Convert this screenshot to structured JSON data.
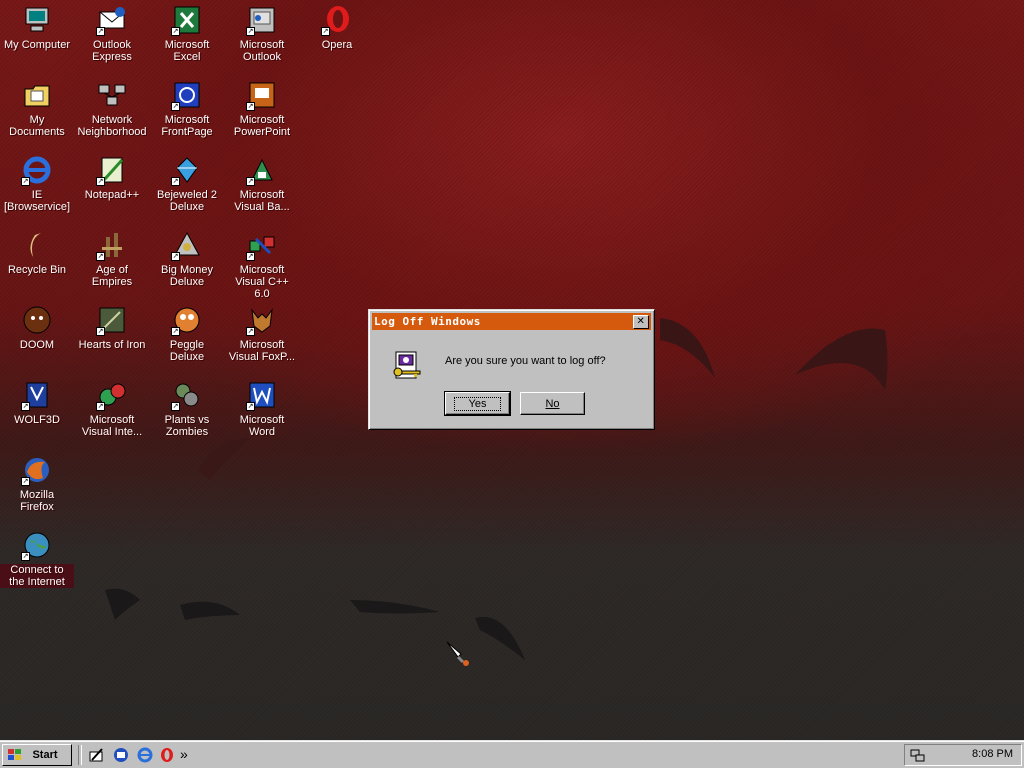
{
  "desktop": {
    "icons": [
      {
        "label": "My Computer",
        "icon": "computer-icon"
      },
      {
        "label": "Outlook Express",
        "icon": "outlook-express-icon"
      },
      {
        "label": "Microsoft Excel",
        "icon": "excel-icon"
      },
      {
        "label": "Microsoft Outlook",
        "icon": "outlook-icon"
      },
      {
        "label": "Opera",
        "icon": "opera-icon"
      },
      {
        "label": "My Documents",
        "icon": "documents-folder-icon"
      },
      {
        "label": "Network Neighborhood",
        "icon": "network-icon"
      },
      {
        "label": "Microsoft FrontPage",
        "icon": "frontpage-icon"
      },
      {
        "label": "Microsoft PowerPoint",
        "icon": "powerpoint-icon"
      },
      {
        "label": "IE [Browservice]",
        "icon": "internet-explorer-icon"
      },
      {
        "label": "Notepad++",
        "icon": "notepad-icon"
      },
      {
        "label": "Bejeweled 2 Deluxe",
        "icon": "bejeweled-icon"
      },
      {
        "label": "Microsoft Visual Ba...",
        "icon": "visual-basic-icon"
      },
      {
        "label": "Recycle Bin",
        "icon": "recycle-bin-icon"
      },
      {
        "label": "Age of Empires",
        "icon": "age-of-empires-icon"
      },
      {
        "label": "Big Money Deluxe",
        "icon": "big-money-icon"
      },
      {
        "label": "Microsoft Visual C++ 6.0",
        "icon": "visual-cpp-icon"
      },
      {
        "label": "DOOM",
        "icon": "doom-icon"
      },
      {
        "label": "Hearts of Iron",
        "icon": "hearts-of-iron-icon"
      },
      {
        "label": "Peggle Deluxe",
        "icon": "peggle-icon"
      },
      {
        "label": "Microsoft Visual FoxP...",
        "icon": "visual-foxpro-icon"
      },
      {
        "label": "WOLF3D",
        "icon": "wolf3d-icon"
      },
      {
        "label": "Microsoft Visual Inte...",
        "icon": "visual-interdev-icon"
      },
      {
        "label": "Plants vs Zombies",
        "icon": "plants-vs-zombies-icon"
      },
      {
        "label": "Microsoft Word",
        "icon": "word-icon"
      },
      {
        "label": "Mozilla Firefox",
        "icon": "firefox-icon"
      },
      {
        "label": "Connect to the Internet",
        "icon": "connect-internet-icon"
      }
    ]
  },
  "dialog": {
    "title": "Log Off Windows",
    "close_glyph": "✕",
    "message": "Are you sure you want to log off?",
    "yes_label": "Yes",
    "no_label": "No",
    "icon": "log-off-key-icon"
  },
  "taskbar": {
    "start_label": "Start",
    "quick_launch": [
      "show-desktop-icon",
      "outlook-express-icon",
      "internet-explorer-icon",
      "opera-icon"
    ],
    "overflow": "»",
    "tray_icon": "network-tray-icon",
    "clock": "8:08 PM"
  },
  "colors": {
    "title_bar": "#d55a0d",
    "desktop_top": "#7a1818",
    "desktop_bottom": "#2a2826",
    "face": "#c0c0c0"
  }
}
